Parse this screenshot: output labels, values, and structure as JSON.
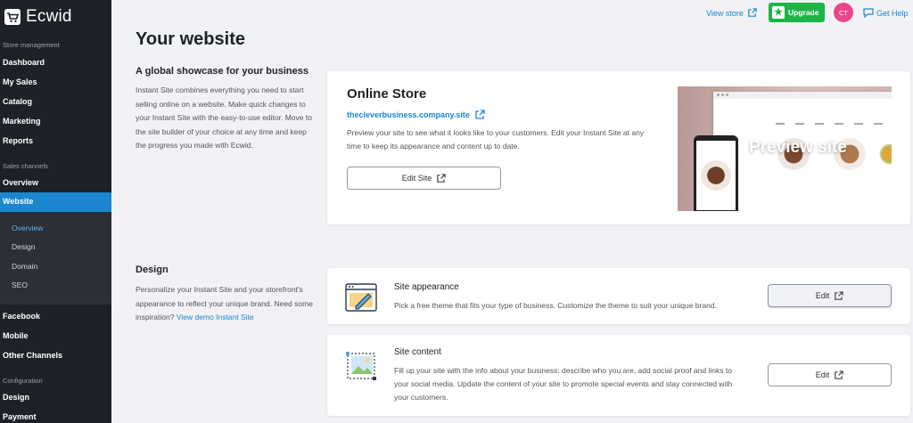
{
  "app": {
    "name": "Ecwid"
  },
  "sidebar": {
    "section_store": "Store management",
    "items_store": [
      "Dashboard",
      "My Sales",
      "Catalog",
      "Marketing",
      "Reports"
    ],
    "section_channels": "Sales channels",
    "overview": "Overview",
    "website": "Website",
    "website_sub": [
      "Overview",
      "Design",
      "Domain",
      "SEO"
    ],
    "items_channels": [
      "Facebook",
      "Mobile",
      "Other Channels"
    ],
    "section_config": "Configuration",
    "items_config": [
      "Design",
      "Payment"
    ]
  },
  "topbar": {
    "view_store": "View store",
    "upgrade": "Upgrade",
    "avatar_initials": "CT",
    "get_help": "Get Help"
  },
  "page": {
    "title": "Your website",
    "showcase": {
      "heading": "A global showcase for your business",
      "text": "Instant Site combines everything you need to start selling online on a website. Make quick changes to your Instant Site with the easy-to-use editor. Move to the site builder of your choice at any time and keep the progress you made with Ecwid."
    },
    "store_card": {
      "title": "Online Store",
      "link": "thecleverbusiness.company.site",
      "desc": "Preview your site to see what it looks like to your customers. Edit your Instant Site at any time to keep its appearance and content up to date.",
      "edit_label": "Edit Site",
      "preview_label": "Preview site"
    },
    "design": {
      "heading": "Design",
      "text_before_link": "Personalize your Instant Site and your storefront's appearance to reflect your unique brand. Need some inspiration? ",
      "link_text": "View demo Instant Site",
      "cards": [
        {
          "title": "Site appearance",
          "desc": "Pick a free theme that fits your type of business. Customize the theme to suit your unique brand.",
          "button": "Edit"
        },
        {
          "title": "Site content",
          "desc": "Fill up your site with the info about your business: describe who you are, add social proof and links to your social media. Update the content of your site to promote special events and stay connected with your customers.",
          "button": "Edit"
        }
      ]
    }
  },
  "colors": {
    "sidebar_bg": "#1e2128",
    "accent": "#1a87d0",
    "upgrade": "#1db548",
    "avatar": "#e9468e"
  }
}
